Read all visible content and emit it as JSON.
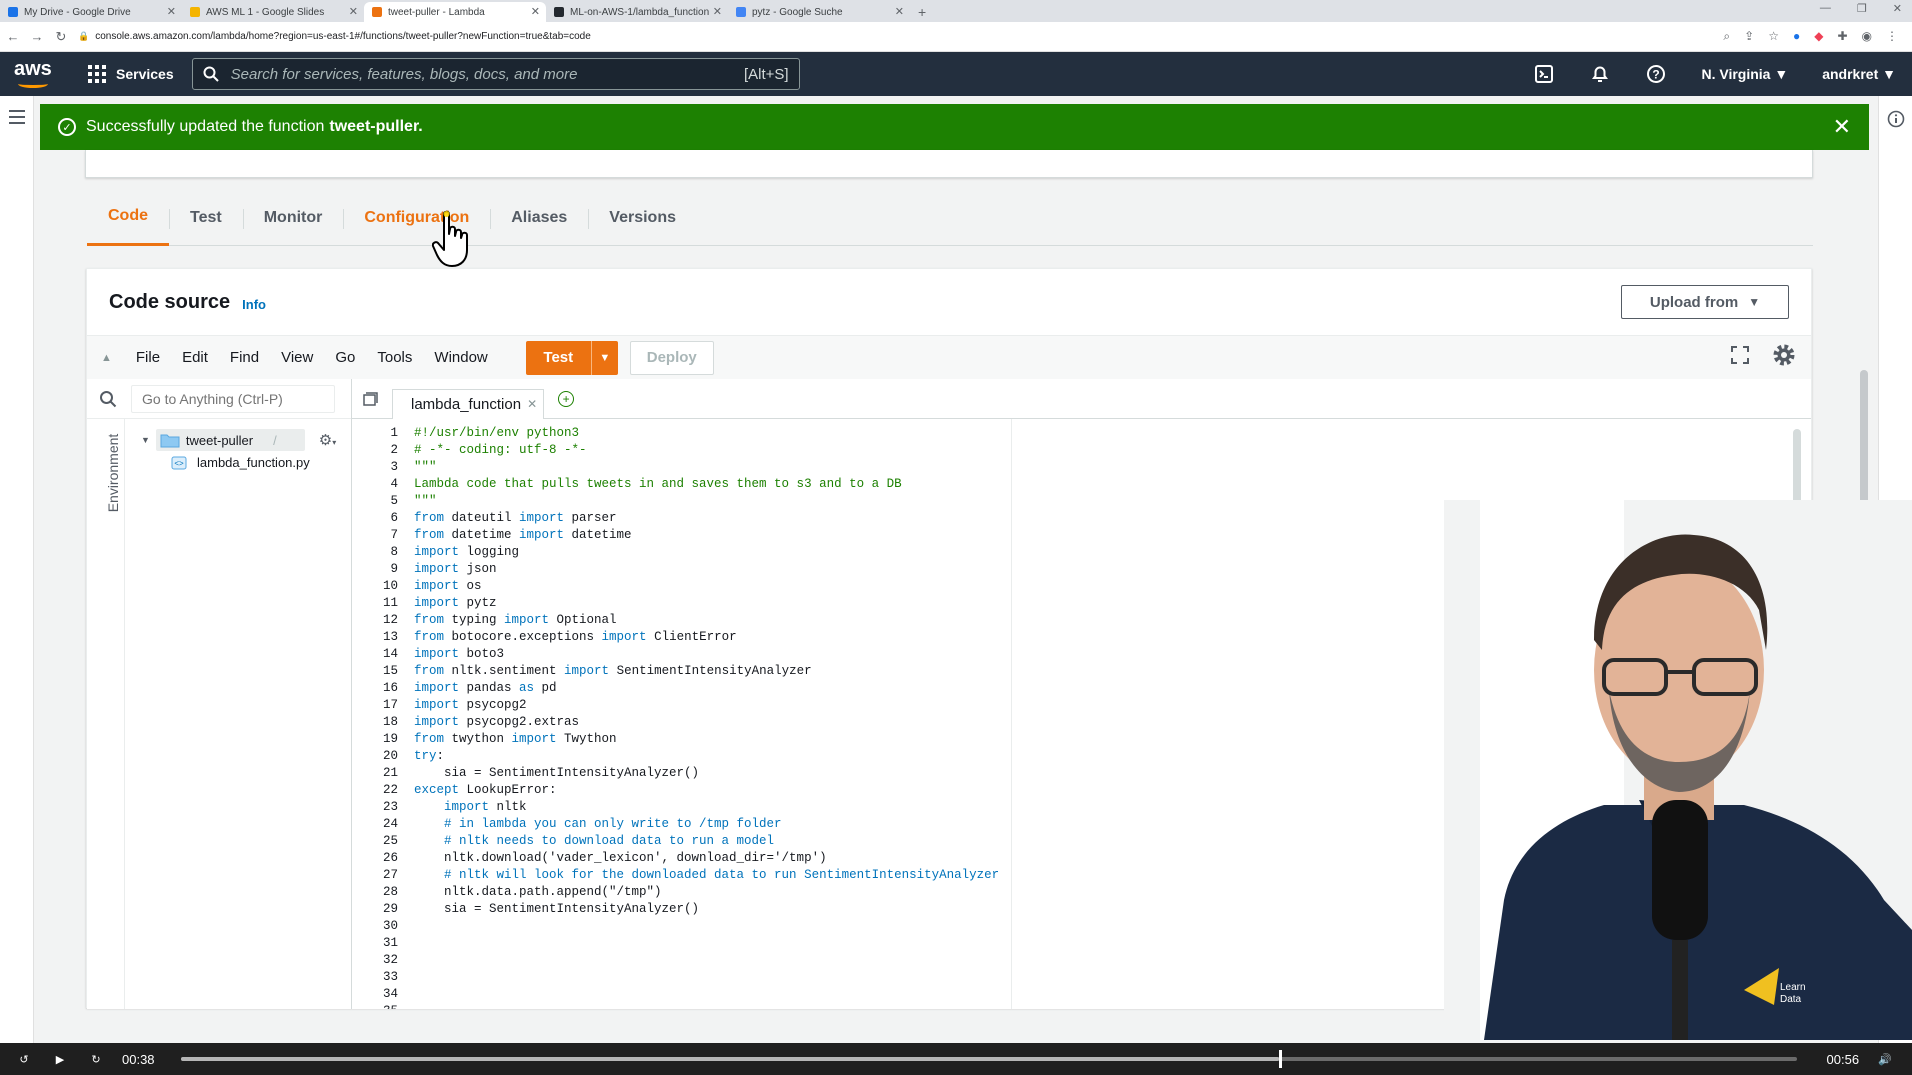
{
  "browser": {
    "tabs": [
      {
        "label": "My Drive - Google Drive",
        "color": "#1a73e8"
      },
      {
        "label": "AWS ML 1 - Google Slides",
        "color": "#f4b400"
      },
      {
        "label": "tweet-puller - Lambda",
        "color": "#ec7211"
      },
      {
        "label": "ML-on-AWS-1/lambda_function...",
        "color": "#24292f"
      },
      {
        "label": "pytz - Google Suche",
        "color": "#4285f4"
      }
    ],
    "active_tab_index": 2,
    "url": "console.aws.amazon.com/lambda/home?region=us-east-1#/functions/tweet-puller?newFunction=true&tab=code"
  },
  "aws_nav": {
    "logo": "aws",
    "services_label": "Services",
    "search_placeholder": "Search for services, features, blogs, docs, and more",
    "search_shortcut": "[Alt+S]",
    "region": "N. Virginia ▼",
    "user": "andrkret ▼"
  },
  "flash": {
    "message": "Successfully updated the function",
    "function_name": "tweet-puller."
  },
  "tabs": [
    "Code",
    "Test",
    "Monitor",
    "Configuration",
    "Aliases",
    "Versions"
  ],
  "active_tab": "Code",
  "hover_tab": "Configuration",
  "code_source": {
    "title": "Code source",
    "info_link": "Info",
    "upload_button": "Upload from"
  },
  "ide": {
    "menu": [
      "File",
      "Edit",
      "Find",
      "View",
      "Go",
      "Tools",
      "Window"
    ],
    "test_label": "Test",
    "deploy_label": "Deploy",
    "goto_placeholder": "Go to Anything (Ctrl-P)",
    "environment_label": "Environment",
    "folder_name": "tweet-puller",
    "folder_suffix": "/",
    "file_name": "lambda_function.py",
    "editor_tab": "lambda_function",
    "code_lines": [
      "#!/usr/bin/env python3",
      "# -*- coding: utf-8 -*-",
      "\"\"\"",
      "Lambda code that pulls tweets in and saves them to s3 and to a DB",
      "\"\"\"",
      "",
      "from dateutil import parser",
      "from datetime import datetime",
      "import logging",
      "import json",
      "import os",
      "import pytz",
      "from typing import Optional",
      "",
      "from botocore.exceptions import ClientError",
      "import boto3",
      "from nltk.sentiment import SentimentIntensityAnalyzer",
      "import pandas as pd",
      "import psycopg2",
      "import psycopg2.extras",
      "from twython import Twython",
      "",
      "",
      "try:",
      "    sia = SentimentIntensityAnalyzer()",
      "except LookupError:",
      "    import nltk",
      "    # in lambda you can only write to /tmp folder",
      "    # nltk needs to download data to run a model",
      "    nltk.download('vader_lexicon', download_dir='/tmp')",
      "    # nltk will look for the downloaded data to run SentimentIntensityAnalyzer",
      "    nltk.data.path.append(\"/tmp\")",
      "    sia = SentimentIntensityAnalyzer()",
      "",
      ""
    ]
  },
  "player": {
    "elapsed": "00:38",
    "duration": "00:56",
    "progress": 0.68
  },
  "colors": {
    "aws_orange": "#ec7211",
    "success_green": "#1d8102",
    "nav_bg": "#232f3e"
  }
}
